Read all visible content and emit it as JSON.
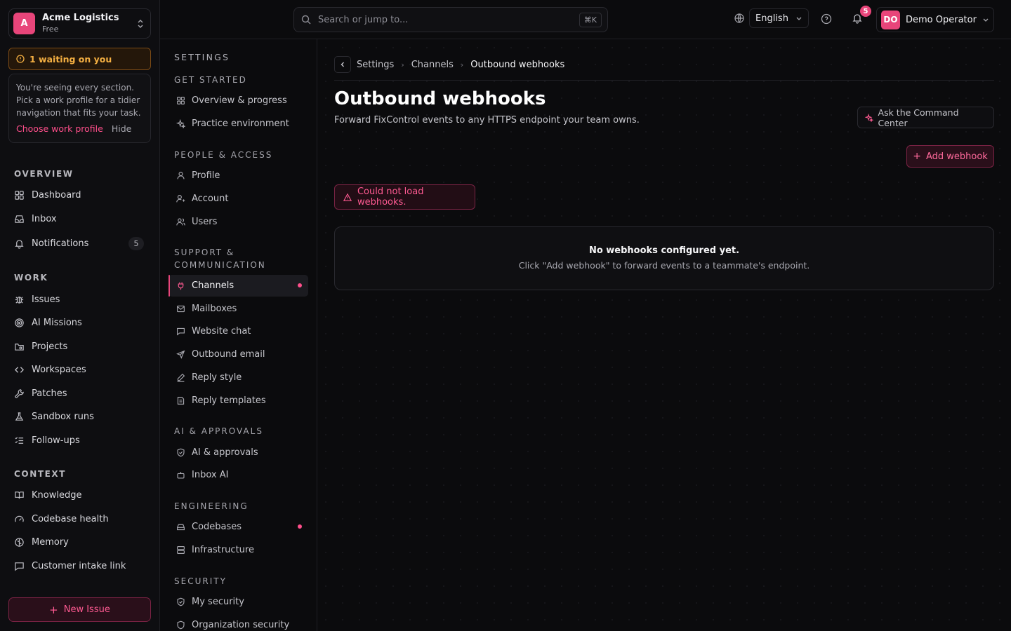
{
  "colors": {
    "accent": "#e8457a",
    "warning": "#f5b042",
    "background": "#0b0b0d"
  },
  "org": {
    "initial": "A",
    "name": "Acme Logistics",
    "plan": "Free"
  },
  "waiting": {
    "label": "1 waiting on you"
  },
  "profile_card": {
    "text": "You're seeing every section. Pick a work profile for a tidier navigation that fits your task.",
    "choose_label": "Choose work profile",
    "hide_label": "Hide"
  },
  "sidebar": {
    "overview_label": "OVERVIEW",
    "overview": [
      {
        "label": "Dashboard",
        "icon": "grid-icon"
      },
      {
        "label": "Inbox",
        "icon": "inbox-icon"
      },
      {
        "label": "Notifications",
        "icon": "bell-icon",
        "count": "5"
      }
    ],
    "work_label": "WORK",
    "work": [
      {
        "label": "Issues",
        "icon": "bug-icon"
      },
      {
        "label": "AI Missions",
        "icon": "target-icon"
      },
      {
        "label": "Projects",
        "icon": "folder-icon"
      },
      {
        "label": "Workspaces",
        "icon": "code-icon"
      },
      {
        "label": "Patches",
        "icon": "wrench-icon"
      },
      {
        "label": "Sandbox runs",
        "icon": "flask-icon"
      },
      {
        "label": "Follow-ups",
        "icon": "checklist-icon"
      }
    ],
    "context_label": "CONTEXT",
    "context": [
      {
        "label": "Knowledge",
        "icon": "book-icon"
      },
      {
        "label": "Codebase health",
        "icon": "gauge-icon"
      },
      {
        "label": "Memory",
        "icon": "brain-icon"
      },
      {
        "label": "Customer intake link",
        "icon": "message-icon"
      }
    ],
    "new_issue_label": "New Issue"
  },
  "topbar": {
    "search_placeholder": "Search or jump to...",
    "search_shortcut": "⌘K",
    "language": "English",
    "notifications_count": "5",
    "user_initials": "DO",
    "user_name": "Demo Operator"
  },
  "settings": {
    "title": "SETTINGS",
    "groups": {
      "get_started": "GET STARTED",
      "people": "PEOPLE & ACCESS",
      "support": "SUPPORT & COMMUNICATION",
      "ai": "AI & APPROVALS",
      "engineering": "ENGINEERING",
      "security": "SECURITY"
    },
    "items": {
      "overview": "Overview & progress",
      "practice": "Practice environment",
      "profile": "Profile",
      "account": "Account",
      "users": "Users",
      "channels": "Channels",
      "mailboxes": "Mailboxes",
      "website_chat": "Website chat",
      "outbound_email": "Outbound email",
      "reply_style": "Reply style",
      "reply_templates": "Reply templates",
      "ai_approvals": "AI & approvals",
      "inbox_ai": "Inbox AI",
      "codebases": "Codebases",
      "infrastructure": "Infrastructure",
      "my_security": "My security",
      "org_security": "Organization security"
    }
  },
  "main": {
    "breadcrumb": [
      "Settings",
      "Channels",
      "Outbound webhooks"
    ],
    "title": "Outbound webhooks",
    "subtitle": "Forward FixControl events to any HTTPS endpoint your team owns.",
    "command_center_label": "Ask the Command Center",
    "add_webhook_label": "Add webhook",
    "error_text": "Could not load webhooks.",
    "empty_title": "No webhooks configured yet.",
    "empty_subtitle": "Click \"Add webhook\" to forward events to a teammate's endpoint."
  }
}
